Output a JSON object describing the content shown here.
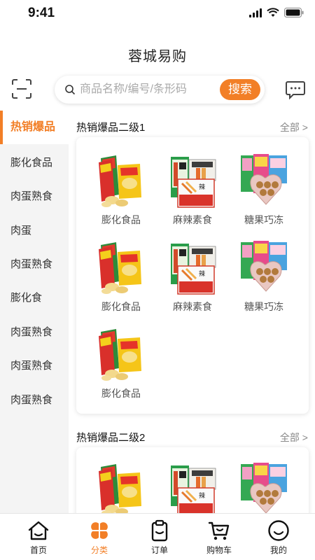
{
  "status": {
    "time": "9:41"
  },
  "header": {
    "title": "蓉城易购"
  },
  "search": {
    "placeholder": "商品名称/编号/条形码",
    "button": "搜索"
  },
  "icons": {
    "scan": "scan-icon",
    "message": "message-icon",
    "search": "search-icon"
  },
  "colors": {
    "accent": "#f27f27",
    "sidebar_bg": "#f4f4f4"
  },
  "sidebar": {
    "items": [
      {
        "label": "热销爆品",
        "active": true
      },
      {
        "label": "膨化食品"
      },
      {
        "label": "肉蛋熟食"
      },
      {
        "label": "肉蛋"
      },
      {
        "label": "肉蛋熟食"
      },
      {
        "label": "膨化食"
      },
      {
        "label": "肉蛋熟食"
      },
      {
        "label": "肉蛋熟食"
      },
      {
        "label": "肉蛋熟食"
      }
    ]
  },
  "sections": [
    {
      "title": "热销爆品二级1",
      "all": "全部 >",
      "products": [
        {
          "name": "膨化食品",
          "image": "chips"
        },
        {
          "name": "麻辣素食",
          "image": "spicy"
        },
        {
          "name": "糖果巧冻",
          "image": "candy"
        },
        {
          "name": "膨化食品",
          "image": "chips"
        },
        {
          "name": "麻辣素食",
          "image": "spicy"
        },
        {
          "name": "糖果巧冻",
          "image": "candy"
        },
        {
          "name": "膨化食品",
          "image": "chips"
        }
      ]
    },
    {
      "title": "热销爆品二级2",
      "all": "全部 >",
      "products": [
        {
          "name": "",
          "image": "chips"
        },
        {
          "name": "",
          "image": "spicy"
        },
        {
          "name": "",
          "image": "candy"
        }
      ]
    }
  ],
  "tabbar": {
    "items": [
      {
        "label": "首页",
        "icon": "home-icon"
      },
      {
        "label": "分类",
        "icon": "category-icon",
        "active": true
      },
      {
        "label": "订单",
        "icon": "order-icon"
      },
      {
        "label": "购物车",
        "icon": "cart-icon"
      },
      {
        "label": "我的",
        "icon": "profile-icon"
      }
    ]
  }
}
